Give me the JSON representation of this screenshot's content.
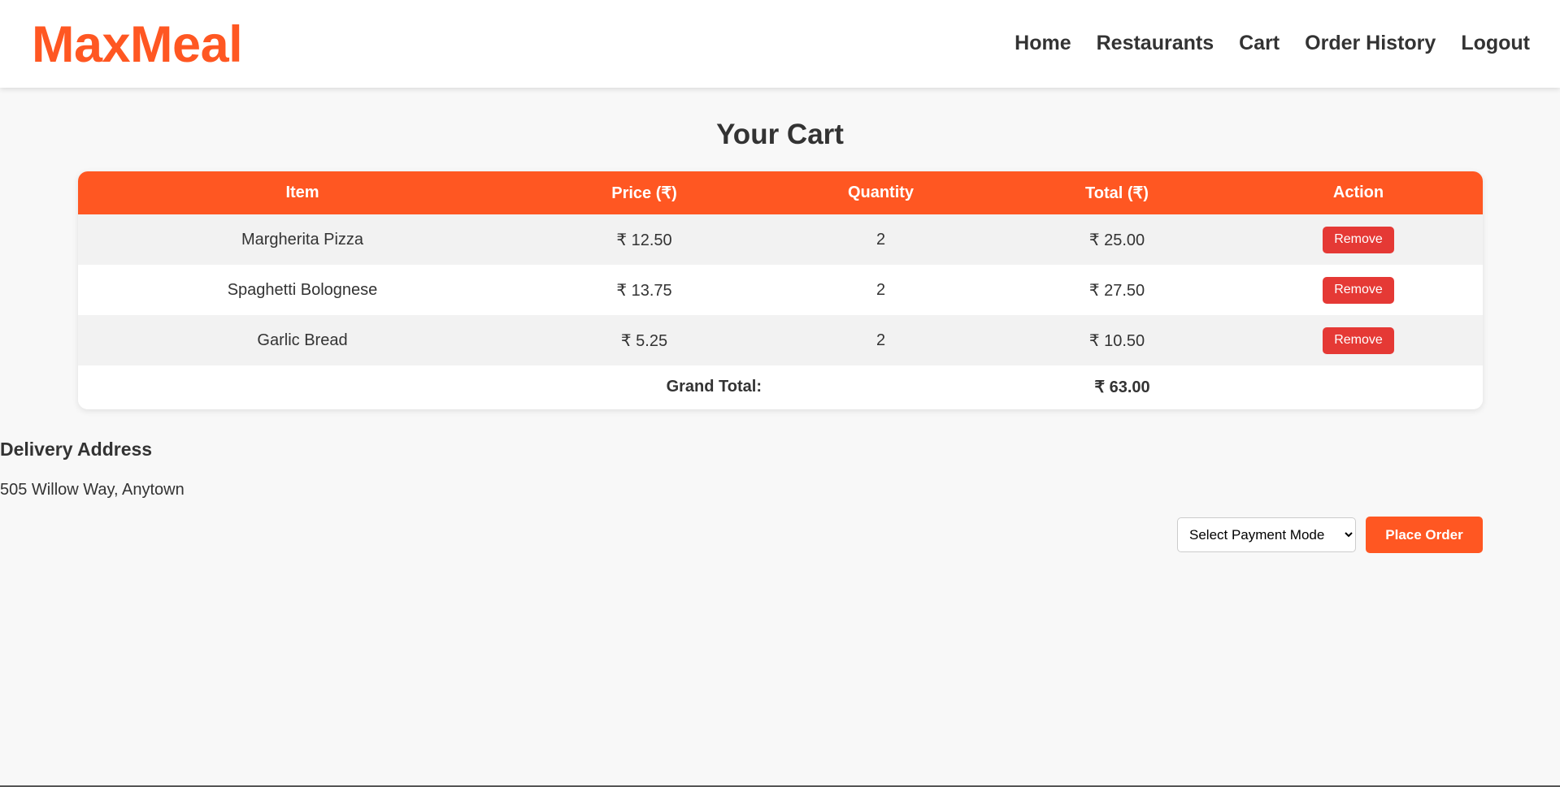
{
  "brand": {
    "name": "MaxMeal",
    "accent_color": "#ff5722"
  },
  "nav": {
    "items": [
      {
        "label": "Home"
      },
      {
        "label": "Restaurants"
      },
      {
        "label": "Cart"
      },
      {
        "label": "Order History"
      },
      {
        "label": "Logout"
      }
    ]
  },
  "page": {
    "title": "Your Cart"
  },
  "cart": {
    "columns": [
      "Item",
      "Price (₹)",
      "Quantity",
      "Total (₹)",
      "Action"
    ],
    "rows": [
      {
        "item": "Margherita Pizza",
        "price": "₹ 12.50",
        "quantity": "2",
        "total": "₹ 25.00",
        "action": "Remove"
      },
      {
        "item": "Spaghetti Bolognese",
        "price": "₹ 13.75",
        "quantity": "2",
        "total": "₹ 27.50",
        "action": "Remove"
      },
      {
        "item": "Garlic Bread",
        "price": "₹ 5.25",
        "quantity": "2",
        "total": "₹ 10.50",
        "action": "Remove"
      }
    ],
    "grand_total_label": "Grand Total:",
    "grand_total_value": "₹ 63.00",
    "remove_color": "#e53935"
  },
  "delivery": {
    "heading": "Delivery Address",
    "address": "505 Willow Way, Anytown"
  },
  "order": {
    "payment_select_value": "Select Payment Mode",
    "place_order_label": "Place Order"
  }
}
